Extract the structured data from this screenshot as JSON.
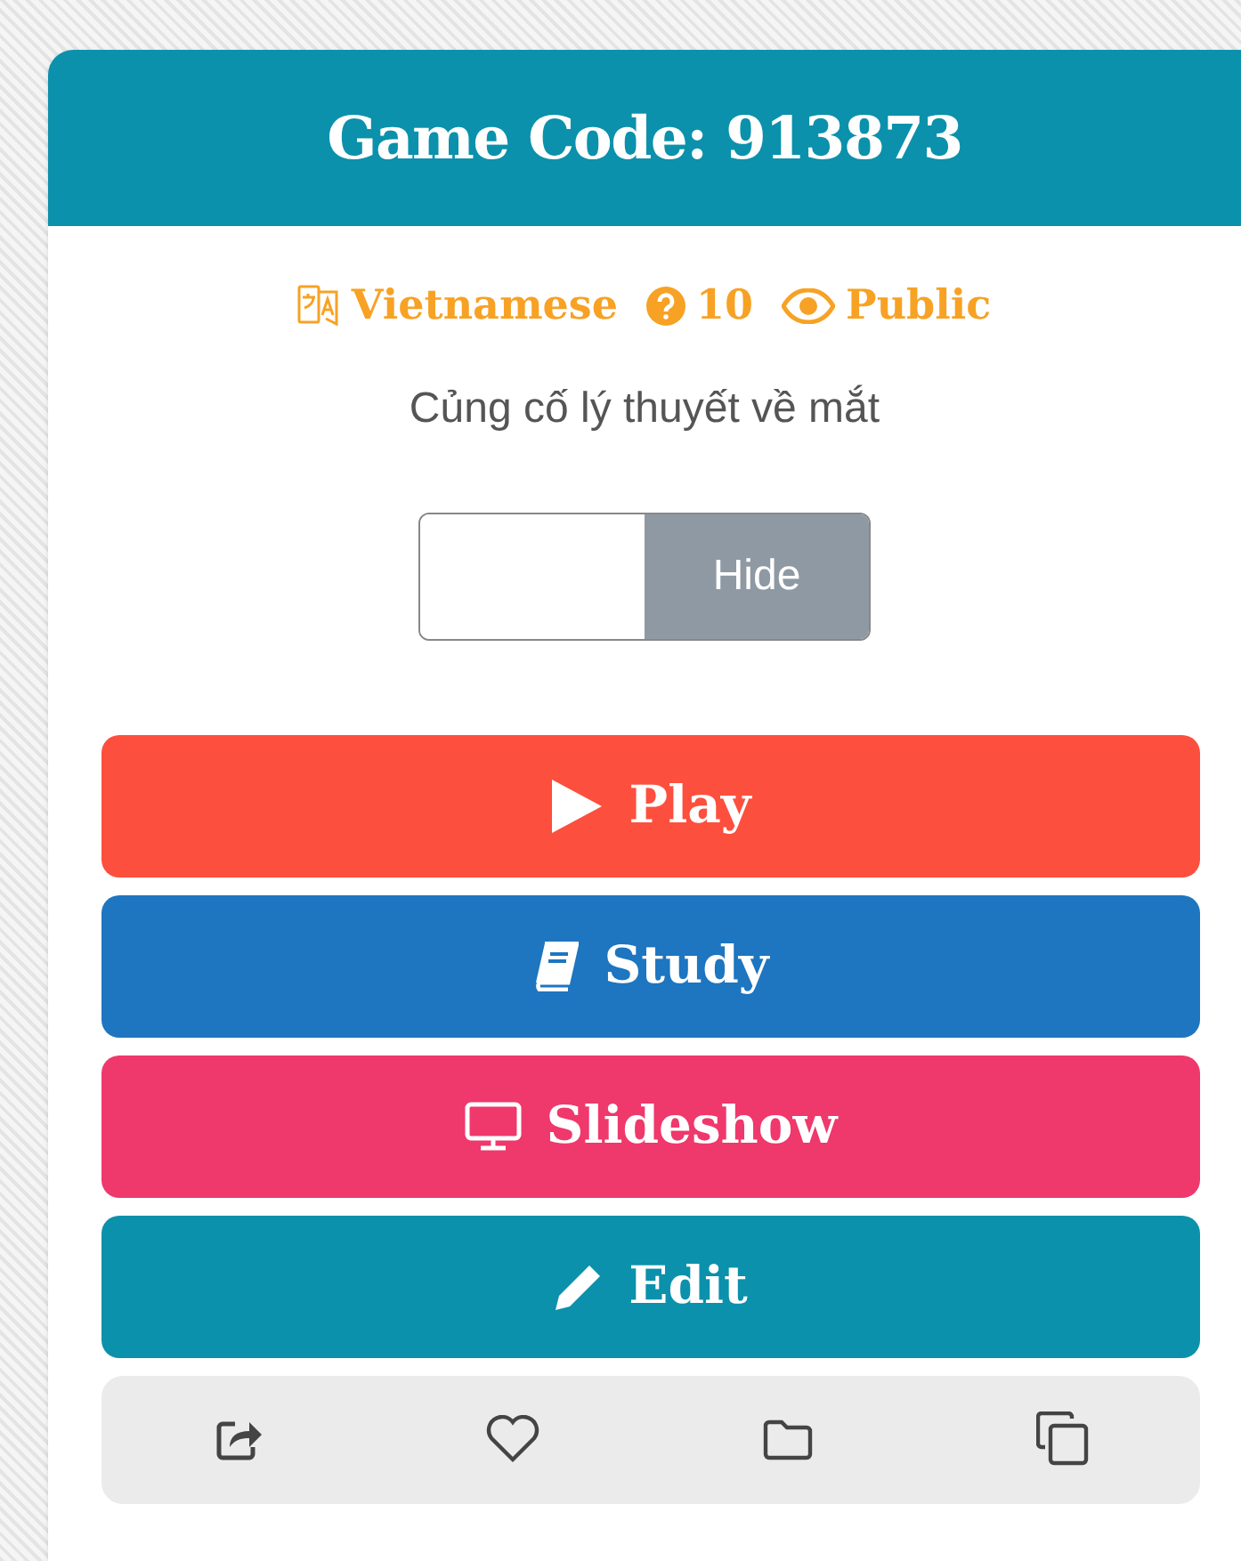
{
  "header": {
    "title": "Game Code: 913873"
  },
  "meta": [
    {
      "kind": "language",
      "text": "Vietnamese"
    },
    {
      "kind": "questions",
      "text": "10"
    },
    {
      "kind": "visibility",
      "text": "Public"
    }
  ],
  "description": "Củng cố lý thuyết về mắt",
  "toggle": {
    "label": "Hide"
  },
  "actions": [
    {
      "kind": "play",
      "label": "Play",
      "color": "#fd4f3d"
    },
    {
      "kind": "study",
      "label": "Study",
      "color": "#1e75c0"
    },
    {
      "kind": "slideshow",
      "label": "Slideshow",
      "color": "#ef386b"
    },
    {
      "kind": "edit",
      "label": "Edit",
      "color": "#0b91ab"
    }
  ]
}
